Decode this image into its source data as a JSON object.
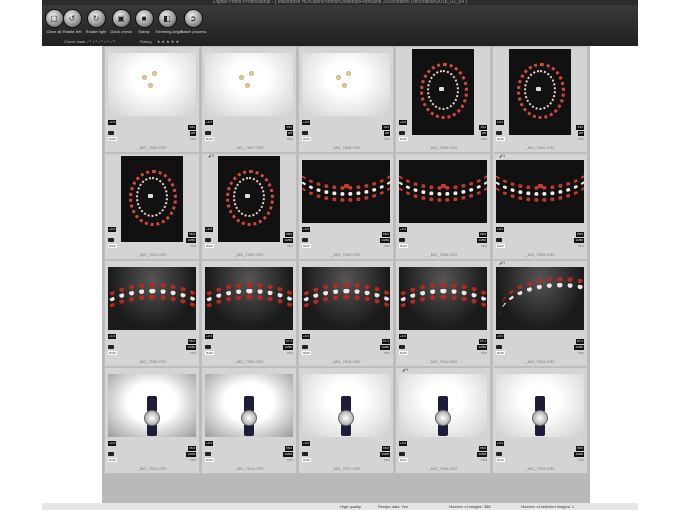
{
  "window": {
    "title": "Digital Photo Professional - [ Macintosh HD/Users/Vector/Desktop/Februarie 2018/Marfe/ Decorative/2018_02_04 ]"
  },
  "toolbar": {
    "tools": [
      {
        "label": "Clear all",
        "icon": "clear-all-icon"
      },
      {
        "label": "Rotate left",
        "icon": "rotate-left-icon"
      },
      {
        "label": "Rotate right",
        "icon": "rotate-right-icon"
      },
      {
        "label": "Quick check",
        "icon": "quick-check-icon"
      },
      {
        "label": "Stamp",
        "icon": "stamp-icon"
      },
      {
        "label": "Trimming Angle",
        "icon": "trimming-icon"
      },
      {
        "label": "Batch process",
        "icon": "batch-process-icon"
      }
    ],
    "check_mark_label": "Check mark",
    "check_marks": "✓¹ ✓² ✓³ ✓⁴ ✓⁵",
    "rating_label": "Rating",
    "rating_stars": "★ ★ ★ ★ ★"
  },
  "thumbnails": {
    "rows": [
      [
        {
          "file": "_MG_7890.CR2",
          "type": "earrings",
          "left_badge": "+0.3",
          "badges": [
            "1/11",
            "2/5"
          ],
          "raw_right": "f/8.0"
        },
        {
          "file": "_MG_7897.CR2",
          "type": "earrings",
          "left_badge": "+0.3",
          "badges": [
            "1/11",
            "2/5"
          ],
          "raw_right": "f/8.0"
        },
        {
          "file": "_MG_7898.CR2",
          "type": "earrings",
          "left_badge": "+0.3",
          "badges": [
            "1/11",
            "2/5"
          ],
          "raw_right": "f/8.0"
        },
        {
          "file": "_MG_7899.CR2",
          "type": "necklace-portrait",
          "left_badge": "+0.3",
          "badges": [
            "1/11",
            "2/5"
          ],
          "raw_right": "f/8.0"
        },
        {
          "file": "_MG_7900.CR2",
          "type": "necklace-portrait",
          "left_badge": "+0.3",
          "badges": [
            "1/11",
            "2/5"
          ],
          "raw_right": "f/8.0"
        }
      ],
      [
        {
          "file": "_MG_7901.CR2",
          "type": "necklace-portrait",
          "left_badge": "+0.3",
          "badges": [
            "f/8.0",
            "1/250"
          ],
          "raw_right": "f/8.0"
        },
        {
          "file": "_MG_7902.CR2",
          "type": "necklace-portrait",
          "left_badge": "+0.3",
          "badges": [
            "f/8.0",
            "1/250"
          ],
          "raw_right": "f/8.0",
          "flag": "✓¹"
        },
        {
          "file": "_MG_7903.CR2",
          "type": "necklace-closeup",
          "left_badge": "+0.3",
          "badges": [
            "f/8.0",
            "1/250"
          ],
          "raw_right": "f/8.0"
        },
        {
          "file": "_MG_7904.CR2",
          "type": "necklace-closeup",
          "left_badge": "+0.3",
          "badges": [
            "f/8.0",
            "1/250"
          ],
          "raw_right": "f/8.0"
        },
        {
          "file": "_MG_7905.CR2",
          "type": "necklace-closeup",
          "left_badge": "+0.3",
          "badges": [
            "f/8.0",
            "1/250"
          ],
          "raw_right": "f/8.0",
          "flag": "✓¹"
        }
      ],
      [
        {
          "file": "_MG_7906.CR2",
          "type": "strand",
          "left_badge": "+0.3",
          "badges": [
            "f/8.0",
            "1/250"
          ],
          "raw_right": "f/8.0"
        },
        {
          "file": "_MG_7909.CR2",
          "type": "strand",
          "left_badge": "+0.3",
          "badges": [
            "f/7.1",
            "1/250"
          ],
          "raw_right": "f/8.0"
        },
        {
          "file": "_MG_7910.CR2",
          "type": "strand",
          "left_badge": "+0.3",
          "badges": [
            "f/7.1",
            "1/250"
          ],
          "raw_right": "f/8.0"
        },
        {
          "file": "_MG_7911.CR2",
          "type": "strand",
          "left_badge": "+0.3",
          "badges": [
            "f/7.1",
            "1/250"
          ],
          "raw_right": "f/8.0"
        },
        {
          "file": "_MG_7912.CR2",
          "type": "strand-curve",
          "left_badge": "+0.3",
          "badges": [
            "f/7.1",
            "1/250"
          ],
          "raw_right": "f/8.0",
          "flag": "✓¹"
        }
      ],
      [
        {
          "file": "_MG_7913.CR2",
          "type": "watch-spot",
          "left_badge": "+0.3",
          "badges": [
            "f/8.0",
            "1/200"
          ],
          "raw_right": "f/8.0"
        },
        {
          "file": "_MG_7914.CR2",
          "type": "watch-spot",
          "left_badge": "+0.3",
          "badges": [
            "f/8.0",
            "1/200"
          ],
          "raw_right": "f/8.0"
        },
        {
          "file": "_MG_7917.CR2",
          "type": "watch",
          "left_badge": "+0.3",
          "badges": [
            "f/8.0",
            "1/200"
          ],
          "raw_right": "f/8.0"
        },
        {
          "file": "_MG_7918.CR2",
          "type": "watch",
          "left_badge": "+0.3",
          "badges": [
            "f/8.0",
            "1/200"
          ],
          "raw_right": "f/8.0",
          "flag": "✓¹"
        },
        {
          "file": "_MG_7919.CR2",
          "type": "watch",
          "left_badge": "+0.3",
          "badges": [
            "f/8.0",
            "1/200"
          ],
          "raw_right": "f/8.0"
        }
      ]
    ],
    "raw_label": "RAW"
  },
  "statusbar": {
    "quality": "High quality",
    "recipe": "Recipe data: Yes",
    "images": "Number of images: 388",
    "selected": "Number of selected images: 1"
  },
  "colors": {
    "toolbar": "#2a2a2a",
    "grid_bg": "#b9b9b9",
    "cell_bg": "#d4d4d4",
    "necklace_red": "#c8392b"
  }
}
